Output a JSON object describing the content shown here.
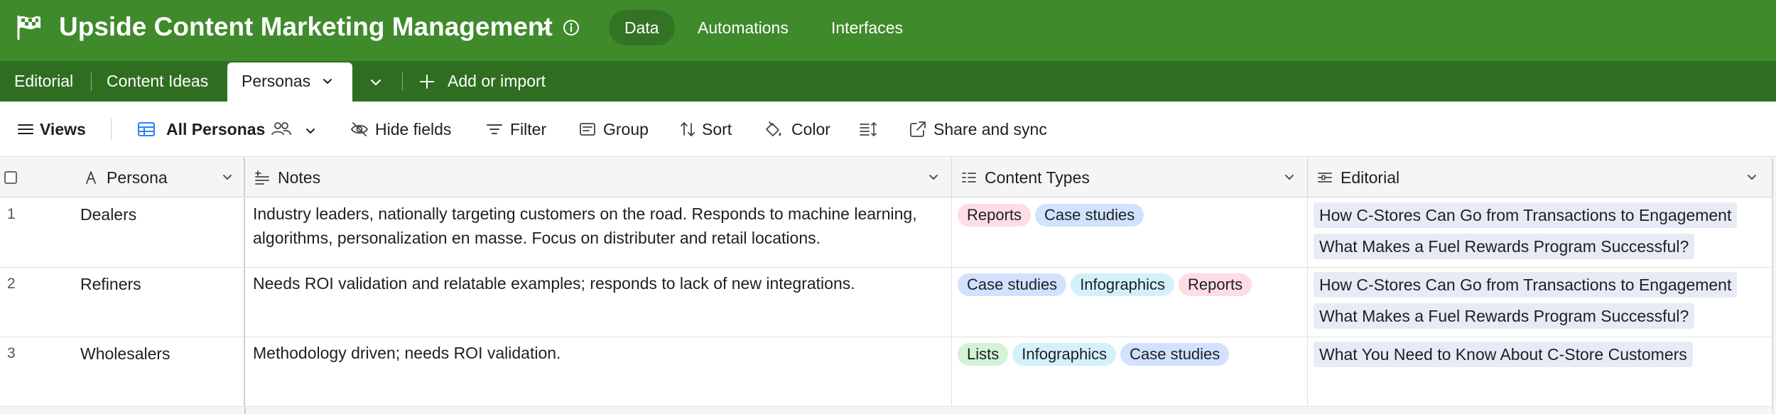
{
  "app": {
    "title": "Upside Content Marketing Management",
    "nav": [
      {
        "label": "Data",
        "active": true
      },
      {
        "label": "Automations",
        "active": false
      },
      {
        "label": "Interfaces",
        "active": false
      }
    ],
    "colors": {
      "header": "#3f8a2b",
      "tabs_bar": "#2f6e20",
      "active_nav": "#337424"
    }
  },
  "tabs": {
    "items": [
      {
        "label": "Editorial"
      },
      {
        "label": "Content Ideas"
      },
      {
        "label": "Personas",
        "active": true
      }
    ],
    "add_label": "Add or import"
  },
  "toolbar": {
    "views_label": "Views",
    "current_view": "All Personas",
    "hide_fields": "Hide fields",
    "filter": "Filter",
    "group": "Group",
    "sort": "Sort",
    "color": "Color",
    "share": "Share and sync"
  },
  "grid": {
    "columns": [
      {
        "label": "Persona",
        "icon": "primary-field-icon"
      },
      {
        "label": "Notes",
        "icon": "long-text-icon"
      },
      {
        "label": "Content Types",
        "icon": "multi-select-icon"
      },
      {
        "label": "Editorial",
        "icon": "linked-record-icon"
      }
    ],
    "rows": [
      {
        "num": "1",
        "persona": "Dealers",
        "notes_line1": "Industry leaders, nationally targeting customers on the road. Responds to machine learning,",
        "notes_line2": "algorithms, personalization en masse. Focus on distributer and retail locations.",
        "types": [
          {
            "label": "Reports",
            "color": "red"
          },
          {
            "label": "Case studies",
            "color": "blue"
          }
        ],
        "editorial": [
          "How C-Stores Can Go from Transactions to Engagement",
          "What Makes a Fuel Rewards Program Successful?"
        ]
      },
      {
        "num": "2",
        "persona": "Refiners",
        "notes_line1": "Needs ROI validation and relatable examples; responds to lack of new integrations.",
        "notes_line2": "",
        "types": [
          {
            "label": "Case studies",
            "color": "blue"
          },
          {
            "label": "Infographics",
            "color": "cyan"
          },
          {
            "label": "Reports",
            "color": "red"
          }
        ],
        "editorial": [
          "How C-Stores Can Go from Transactions to Engagement",
          "What Makes a Fuel Rewards Program Successful?"
        ]
      },
      {
        "num": "3",
        "persona": "Wholesalers",
        "notes_line1": "Methodology driven; needs ROI validation.",
        "notes_line2": "",
        "types": [
          {
            "label": "Lists",
            "color": "green"
          },
          {
            "label": "Infographics",
            "color": "cyan"
          },
          {
            "label": "Case studies",
            "color": "blue"
          }
        ],
        "editorial": [
          "What You Need to Know About C-Store Customers"
        ]
      }
    ]
  }
}
